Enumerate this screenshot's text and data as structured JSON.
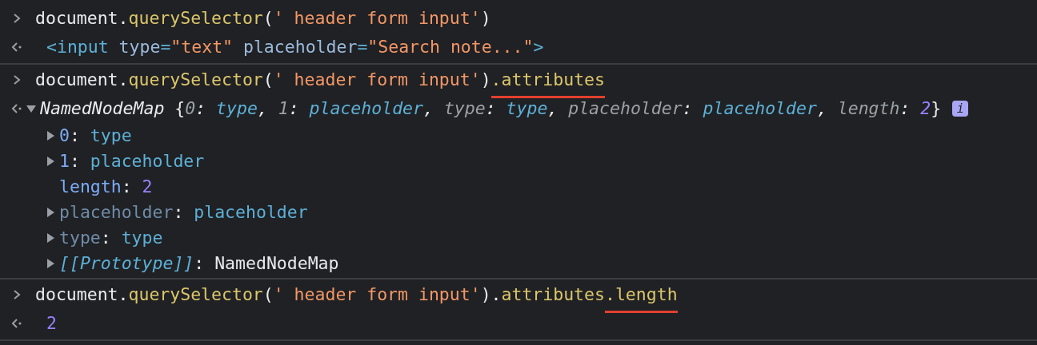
{
  "console": {
    "groups": [
      {
        "input": [
          {
            "text": "document.",
            "kind": "plain",
            "underlined": false
          },
          {
            "text": "querySelector",
            "kind": "method",
            "underlined": false
          },
          {
            "text": "(",
            "kind": "plain",
            "underlined": false
          },
          {
            "text": "' header form input'",
            "kind": "string",
            "underlined": false
          },
          {
            "text": ")",
            "kind": "plain",
            "underlined": false
          }
        ],
        "output": {
          "kind": "value",
          "tokens": [
            {
              "text": "<input",
              "kind": "tag"
            },
            {
              "text": " type",
              "kind": "attr"
            },
            {
              "text": "=",
              "kind": "tag"
            },
            {
              "text": "\"text\"",
              "kind": "string"
            },
            {
              "text": " placeholder",
              "kind": "attr"
            },
            {
              "text": "=",
              "kind": "tag"
            },
            {
              "text": "\"Search note...\"",
              "kind": "string"
            },
            {
              "text": ">",
              "kind": "tag"
            }
          ]
        }
      },
      {
        "input": [
          {
            "text": "document.",
            "kind": "plain",
            "underlined": false
          },
          {
            "text": "querySelector",
            "kind": "method",
            "underlined": false
          },
          {
            "text": "(",
            "kind": "plain",
            "underlined": false
          },
          {
            "text": "' header form input'",
            "kind": "string",
            "underlined": false
          },
          {
            "text": ")",
            "kind": "plain",
            "underlined": false
          },
          {
            "text": ".attributes",
            "kind": "method",
            "underlined": true
          }
        ],
        "output": {
          "kind": "node",
          "expanded": true,
          "badge": "i",
          "tokens": [
            {
              "text": "NamedNodeMap",
              "kind": "class-name"
            },
            {
              "text": " {",
              "kind": "plain"
            },
            {
              "text": "0",
              "kind": "preview-key"
            },
            {
              "text": ": ",
              "kind": "plain-italic"
            },
            {
              "text": "type",
              "kind": "preview-value"
            },
            {
              "text": ", ",
              "kind": "plain-italic"
            },
            {
              "text": "1",
              "kind": "preview-key"
            },
            {
              "text": ": ",
              "kind": "plain-italic"
            },
            {
              "text": "placeholder",
              "kind": "preview-value"
            },
            {
              "text": ", ",
              "kind": "plain-italic"
            },
            {
              "text": "type",
              "kind": "preview-key"
            },
            {
              "text": ": ",
              "kind": "plain-italic"
            },
            {
              "text": "type",
              "kind": "preview-value"
            },
            {
              "text": ", ",
              "kind": "plain-italic"
            },
            {
              "text": "placeholder",
              "kind": "preview-key"
            },
            {
              "text": ": ",
              "kind": "plain-italic"
            },
            {
              "text": "placeholder",
              "kind": "preview-value"
            },
            {
              "text": ", ",
              "kind": "plain-italic"
            },
            {
              "text": "length",
              "kind": "preview-key"
            },
            {
              "text": ": ",
              "kind": "plain-italic"
            },
            {
              "text": "2",
              "kind": "preview-number"
            },
            {
              "text": "}",
              "kind": "plain"
            }
          ],
          "children": [
            {
              "kind": "node",
              "expanded": false,
              "tokens": [
                {
                  "text": "0",
                  "kind": "prop-key"
                },
                {
                  "text": ": ",
                  "kind": "plain"
                },
                {
                  "text": "type",
                  "kind": "prop-value"
                }
              ]
            },
            {
              "kind": "node",
              "expanded": false,
              "tokens": [
                {
                  "text": "1",
                  "kind": "prop-key"
                },
                {
                  "text": ": ",
                  "kind": "plain"
                },
                {
                  "text": "placeholder",
                  "kind": "prop-value"
                }
              ]
            },
            {
              "kind": "leaf",
              "tokens": [
                {
                  "text": "length",
                  "kind": "prop-key"
                },
                {
                  "text": ": ",
                  "kind": "plain"
                },
                {
                  "text": "2",
                  "kind": "number"
                }
              ]
            },
            {
              "kind": "node",
              "expanded": false,
              "tokens": [
                {
                  "text": "placeholder",
                  "kind": "dim-key"
                },
                {
                  "text": ": ",
                  "kind": "plain"
                },
                {
                  "text": "placeholder",
                  "kind": "prop-value"
                }
              ]
            },
            {
              "kind": "node",
              "expanded": false,
              "tokens": [
                {
                  "text": "type",
                  "kind": "dim-key"
                },
                {
                  "text": ": ",
                  "kind": "plain"
                },
                {
                  "text": "type",
                  "kind": "prop-value"
                }
              ]
            },
            {
              "kind": "node",
              "expanded": false,
              "tokens": [
                {
                  "text": "[[Prototype]]",
                  "kind": "internal-key"
                },
                {
                  "text": ": ",
                  "kind": "plain"
                },
                {
                  "text": "NamedNodeMap",
                  "kind": "plain"
                }
              ]
            }
          ]
        }
      },
      {
        "input": [
          {
            "text": "document.",
            "kind": "plain",
            "underlined": false
          },
          {
            "text": "querySelector",
            "kind": "method",
            "underlined": false
          },
          {
            "text": "(",
            "kind": "plain",
            "underlined": false
          },
          {
            "text": "' header form input'",
            "kind": "string",
            "underlined": false
          },
          {
            "text": ").",
            "kind": "plain",
            "underlined": false
          },
          {
            "text": "attributes",
            "kind": "method",
            "underlined": false
          },
          {
            "text": ".length",
            "kind": "method",
            "underlined": true
          }
        ],
        "output": {
          "kind": "value",
          "tokens": [
            {
              "text": "2",
              "kind": "number"
            }
          ]
        }
      }
    ]
  }
}
